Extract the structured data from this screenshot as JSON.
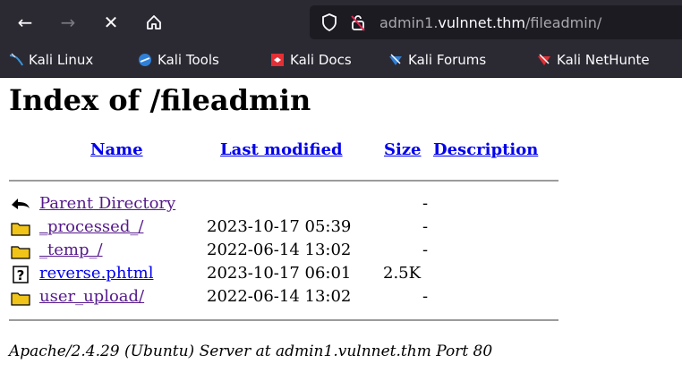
{
  "browser": {
    "back_icon": "arrow-left-icon",
    "forward_icon": "arrow-right-icon",
    "stop_icon": "close-icon",
    "home_icon": "home-icon",
    "url_prefix": "admin1.",
    "url_host": "vulnnet.thm",
    "url_path": "/fileadmin/"
  },
  "bookmarks": [
    {
      "label": "Kali Linux",
      "icon": "kali-dragon-icon"
    },
    {
      "label": "Kali Tools",
      "icon": "kali-tools-icon"
    },
    {
      "label": "Kali Docs",
      "icon": "kali-docs-icon"
    },
    {
      "label": "Kali Forums",
      "icon": "kali-forums-icon"
    },
    {
      "label": "Kali NetHunte",
      "icon": "kali-nethunter-icon"
    }
  ],
  "page": {
    "title": "Index of /fileadmin",
    "headers": {
      "name": "Name",
      "modified": "Last modified",
      "size": "Size",
      "description": "Description"
    },
    "rows": [
      {
        "name": "Parent Directory",
        "modified": "",
        "size": "-",
        "icon": "back-arrow-icon"
      },
      {
        "name": "_processed_/",
        "modified": "2023-10-17 05:39",
        "size": "-",
        "icon": "folder-icon"
      },
      {
        "name": "_temp_/",
        "modified": "2022-06-14 13:02",
        "size": "-",
        "icon": "folder-icon"
      },
      {
        "name": "reverse.phtml",
        "modified": "2023-10-17 06:01",
        "size": "2.5K",
        "icon": "unknown-file-icon"
      },
      {
        "name": "user_upload/",
        "modified": "2022-06-14 13:02",
        "size": "-",
        "icon": "folder-icon"
      }
    ],
    "server_address": "Apache/2.4.29 (Ubuntu) Server at admin1.vulnnet.thm Port 80"
  }
}
